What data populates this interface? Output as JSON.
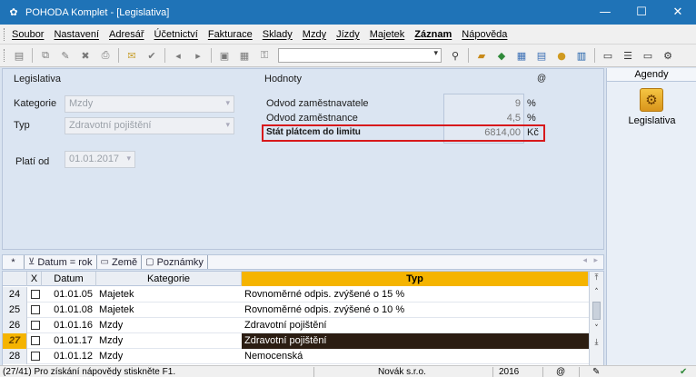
{
  "window": {
    "title": "POHODA Komplet - [Legislativa]",
    "min": "—",
    "max": "☐",
    "close": "✕"
  },
  "menu": [
    {
      "label": "Soubor",
      "bold": false
    },
    {
      "label": "Nastavení",
      "bold": false
    },
    {
      "label": "Adresář",
      "bold": false
    },
    {
      "label": "Účetnictví",
      "bold": false
    },
    {
      "label": "Fakturace",
      "bold": false
    },
    {
      "label": "Sklady",
      "bold": false
    },
    {
      "label": "Mzdy",
      "bold": false
    },
    {
      "label": "Jízdy",
      "bold": false
    },
    {
      "label": "Majetek",
      "bold": false
    },
    {
      "label": "Záznam",
      "bold": true
    },
    {
      "label": "Nápověda",
      "bold": false
    }
  ],
  "form": {
    "legislativa_title": "Legislativa",
    "kategorie_label": "Kategorie",
    "kategorie_value": "Mzdy",
    "typ_label": "Typ",
    "typ_value": "Zdravotní pojištění",
    "plati_label": "Platí od",
    "plati_value": "01.01.2017",
    "hodnoty_title": "Hodnoty",
    "at_symbol": "@",
    "rows": [
      {
        "label": "Odvod zaměstnavatele",
        "value": "9",
        "unit": "%"
      },
      {
        "label": "Odvod zaměstnance",
        "value": "4,5",
        "unit": "%"
      },
      {
        "label": "Stát plátcem do limitu",
        "value": "6814,00",
        "unit": "Kč"
      }
    ]
  },
  "agenda": {
    "title": "Agendy",
    "item": "Legislativa"
  },
  "tabs": [
    {
      "label": "*",
      "icon": ""
    },
    {
      "label": "Datum = rok",
      "icon": "⊻"
    },
    {
      "label": "Země",
      "icon": "▭"
    },
    {
      "label": "Poznámky",
      "icon": "▢"
    }
  ],
  "grid": {
    "headers": {
      "x": "X",
      "datum": "Datum",
      "kategorie": "Kategorie",
      "typ": "Typ"
    },
    "rows": [
      {
        "num": "24",
        "date": "01.01.05",
        "kat": "Majetek",
        "typ": "Rovnoměrné odpis. zvýšené o 15 %",
        "selected": false
      },
      {
        "num": "25",
        "date": "01.01.08",
        "kat": "Majetek",
        "typ": "Rovnoměrné odpis. zvýšené o 10 %",
        "selected": false
      },
      {
        "num": "26",
        "date": "01.01.16",
        "kat": "Mzdy",
        "typ": "Zdravotní pojištění",
        "selected": false
      },
      {
        "num": "27",
        "date": "01.01.17",
        "kat": "Mzdy",
        "typ": "Zdravotní pojištění",
        "selected": true
      },
      {
        "num": "28",
        "date": "01.01.12",
        "kat": "Mzdy",
        "typ": "Nemocenská",
        "selected": false
      }
    ]
  },
  "status": {
    "hint": "(27/41) Pro získání nápovědy stiskněte F1.",
    "company": "Novák s.r.o.",
    "year": "2016"
  },
  "colors": {
    "titlebar": "#1f73b7",
    "highlight_border": "#d7191c",
    "typ_header": "#f5b400",
    "selected_row": "#2b1d12"
  }
}
